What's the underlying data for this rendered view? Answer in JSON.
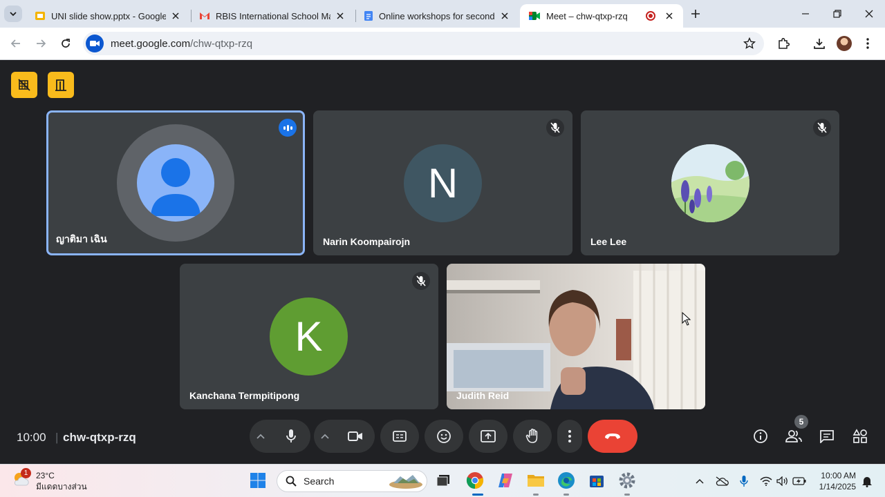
{
  "browser": {
    "tabs": [
      {
        "title": "UNI slide show.pptx - Google Sl",
        "icon": "google-slides-icon"
      },
      {
        "title": "RBIS International School Mail",
        "icon": "gmail-icon"
      },
      {
        "title": "Online workshops for secondary",
        "icon": "google-docs-icon"
      },
      {
        "title": "Meet – chw-qtxp-rzq",
        "icon": "google-meet-icon",
        "active": true
      }
    ],
    "url_host": "meet.google.com",
    "url_path": "/chw-qtxp-rzq"
  },
  "meet": {
    "participants": [
      {
        "name": "ญาติมา เฉิน",
        "avatar": "default-person",
        "speaking": true
      },
      {
        "name": "Narin Koompairojn",
        "initial": "N",
        "color": "#3f5662",
        "muted": true
      },
      {
        "name": "Lee Lee",
        "avatar": "lupine-landscape-photo",
        "muted": true
      },
      {
        "name": "Kanchana Termpitipong",
        "initial": "K",
        "color": "#5f9d32",
        "muted": true
      },
      {
        "name": "Judith Reid",
        "avatar": "camera-video"
      }
    ],
    "time": "10:00",
    "meeting_code": "chw-qtxp-rzq",
    "people_count": "5"
  },
  "taskbar": {
    "weather_temp": "23°C",
    "weather_desc": "มีแดดบางส่วน",
    "weather_alert": "1",
    "search_label": "Search",
    "time": "10:00 AM",
    "date": "1/14/2025"
  },
  "colors": {
    "accent": "#f9bb1c",
    "end_call": "#ea4335",
    "speaking_outline": "#8ab4f8"
  }
}
